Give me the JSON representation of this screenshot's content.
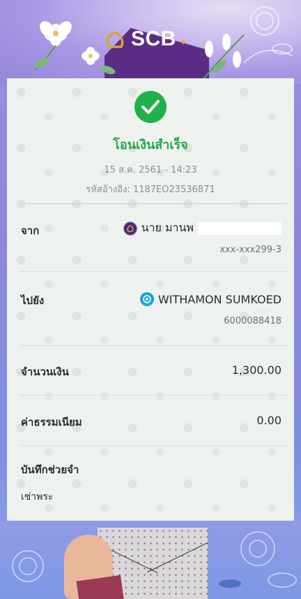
{
  "brand": {
    "name": "SCB",
    "sparkle": "✦"
  },
  "status": {
    "title": "โอนเงินสำเร็จ",
    "icon": "check-circle-icon"
  },
  "transaction": {
    "datetime": "15 ส.ค. 2561 - 14:23",
    "reference": "รหัสอ้างอิง: 1187EO23536871"
  },
  "from": {
    "label": "จาก",
    "name": "นาย มานพ",
    "account": "xxx-xxx299-3",
    "bank_icon": "scb-logo-icon"
  },
  "to": {
    "label": "ไปยัง",
    "name": "WITHAMON SUMKOED",
    "account": "6000088418",
    "bank_icon": "ktb-logo-icon"
  },
  "amount": {
    "label": "จำนวนเงิน",
    "value": "1,300.00"
  },
  "fee": {
    "label": "ค่าธรรมเนียม",
    "value": "0.00"
  },
  "memo": {
    "label": "บันทึกช่วยจำ",
    "value": "เช่าพระ"
  },
  "colors": {
    "success": "#1fb24a",
    "brand_purple": "#4a2a7a",
    "ktb_blue": "#1aa3d9"
  }
}
